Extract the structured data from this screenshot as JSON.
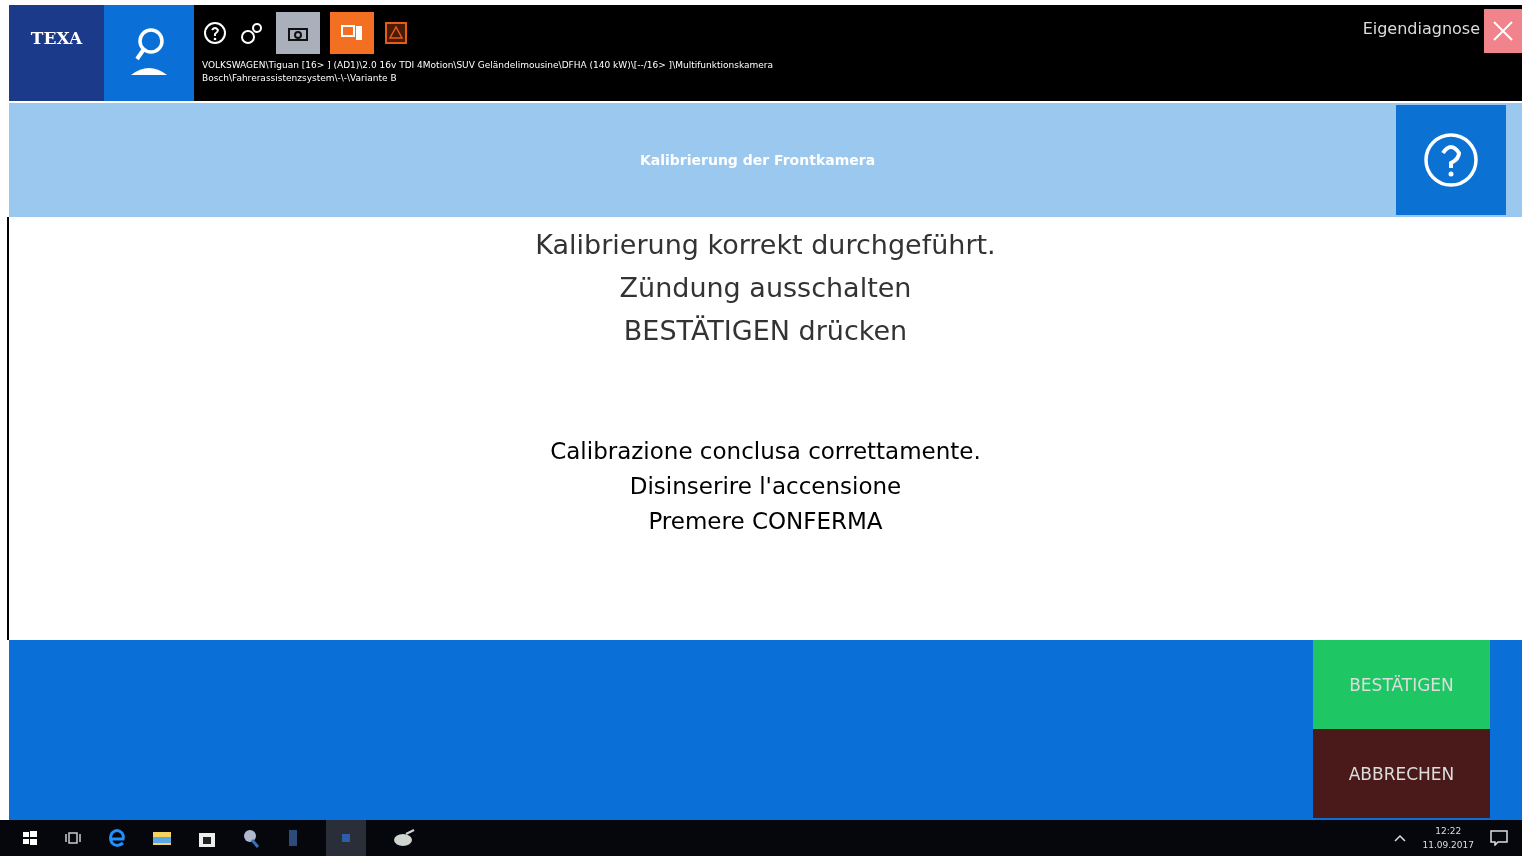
{
  "top_bar": {
    "logo": "TEXA",
    "path_lines": [
      "VOLKSWAGEN\\Tiguan [16> ] (AD1)\\2.0 16v TDI 4Motion\\SUV Geländelimousine\\DFHA (140 kW)\\[--/16> ]\\Multifunktionskamera",
      "Bosch\\Fahrerassistenzsystem\\-\\-\\Variante B"
    ],
    "self_diagnosis": "Eigendiagnose"
  },
  "header": {
    "title": "Kalibrierung der Frontkamera"
  },
  "messages": [
    {
      "kind": "primary",
      "lines": [
        "Kalibrierung korrekt durchgeführt.",
        "Zündung ausschalten",
        "BESTÄTIGEN drücken"
      ]
    },
    {
      "kind": "secondary",
      "lines": [
        "Calibrazione conclusa correttamente.",
        "Disinserire l'accensione",
        "Premere CONFERMA"
      ]
    }
  ],
  "buttons": [
    {
      "kind": "confirm",
      "label": "BESTÄTIGEN"
    },
    {
      "kind": "cancel",
      "label": "ABBRECHEN"
    }
  ],
  "taskbar": {
    "time": "12:22",
    "date": "11.09.2017"
  }
}
